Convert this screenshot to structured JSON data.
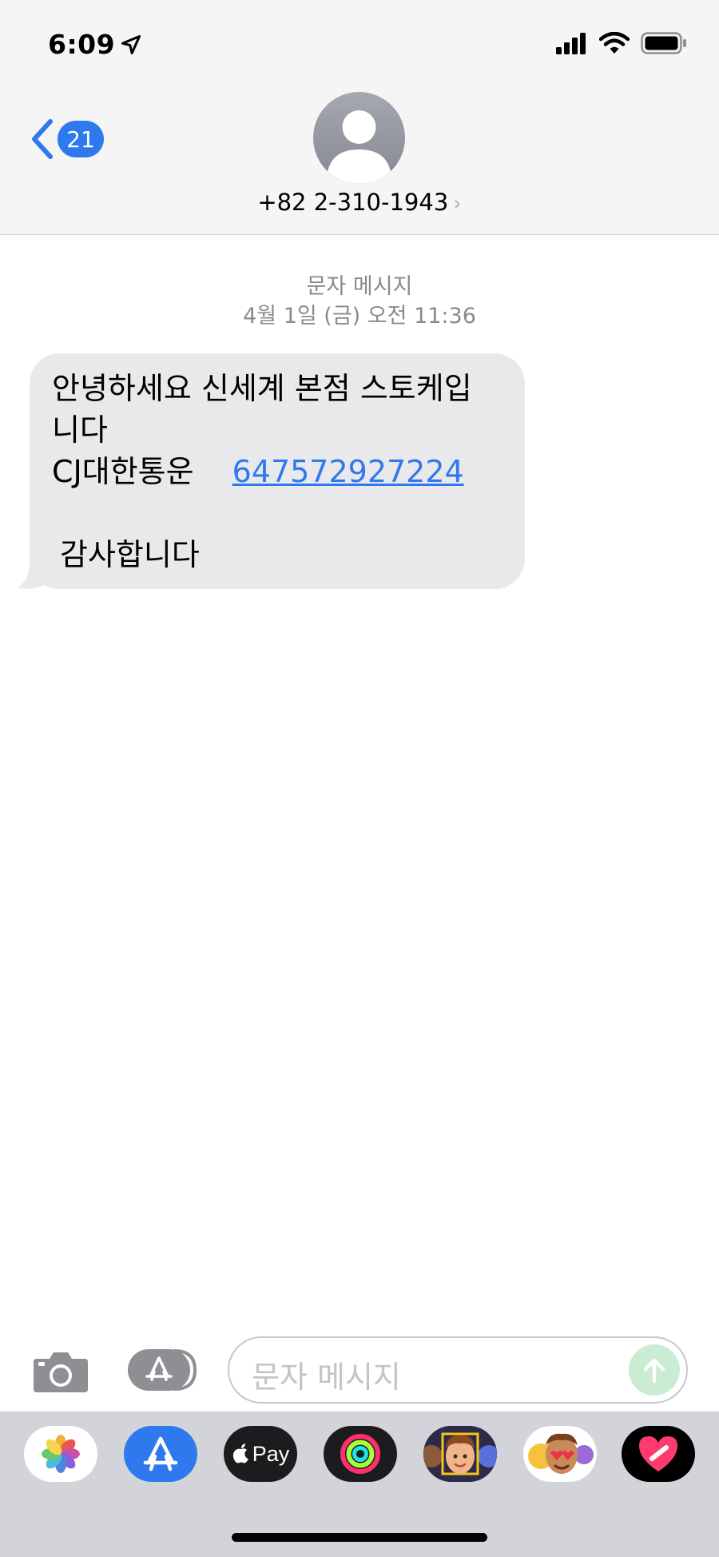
{
  "status_bar": {
    "time": "6:09"
  },
  "header": {
    "back_count": "21",
    "contact_number": "+82 2-310-1943",
    "contact_chevron": "›"
  },
  "conversation": {
    "message_type": "문자 메시지",
    "timestamp": "4월 1일 (금) 오전 11:36",
    "message": {
      "line1": "안녕하세요 신세계 본점 스토케입",
      "line2": "니다",
      "line3_text": "CJ대한통운",
      "line3_link": "647572927224",
      "line4": "감사합니다"
    }
  },
  "input_bar": {
    "placeholder": "문자 메시지"
  },
  "app_drawer": {
    "apps": [
      "photos-app",
      "app-store-app",
      "apple-pay-app",
      "activity-app",
      "memoji-app",
      "animoji-stickers-app",
      "digital-touch-app"
    ],
    "apple_pay_label": "Pay"
  },
  "colors": {
    "accent": "#2f79ee",
    "bubble": "#e9e9eb",
    "header_bg": "#f5f5f5",
    "send_button": "#c9ecd3",
    "drawer_bg": "#d2d4da"
  }
}
